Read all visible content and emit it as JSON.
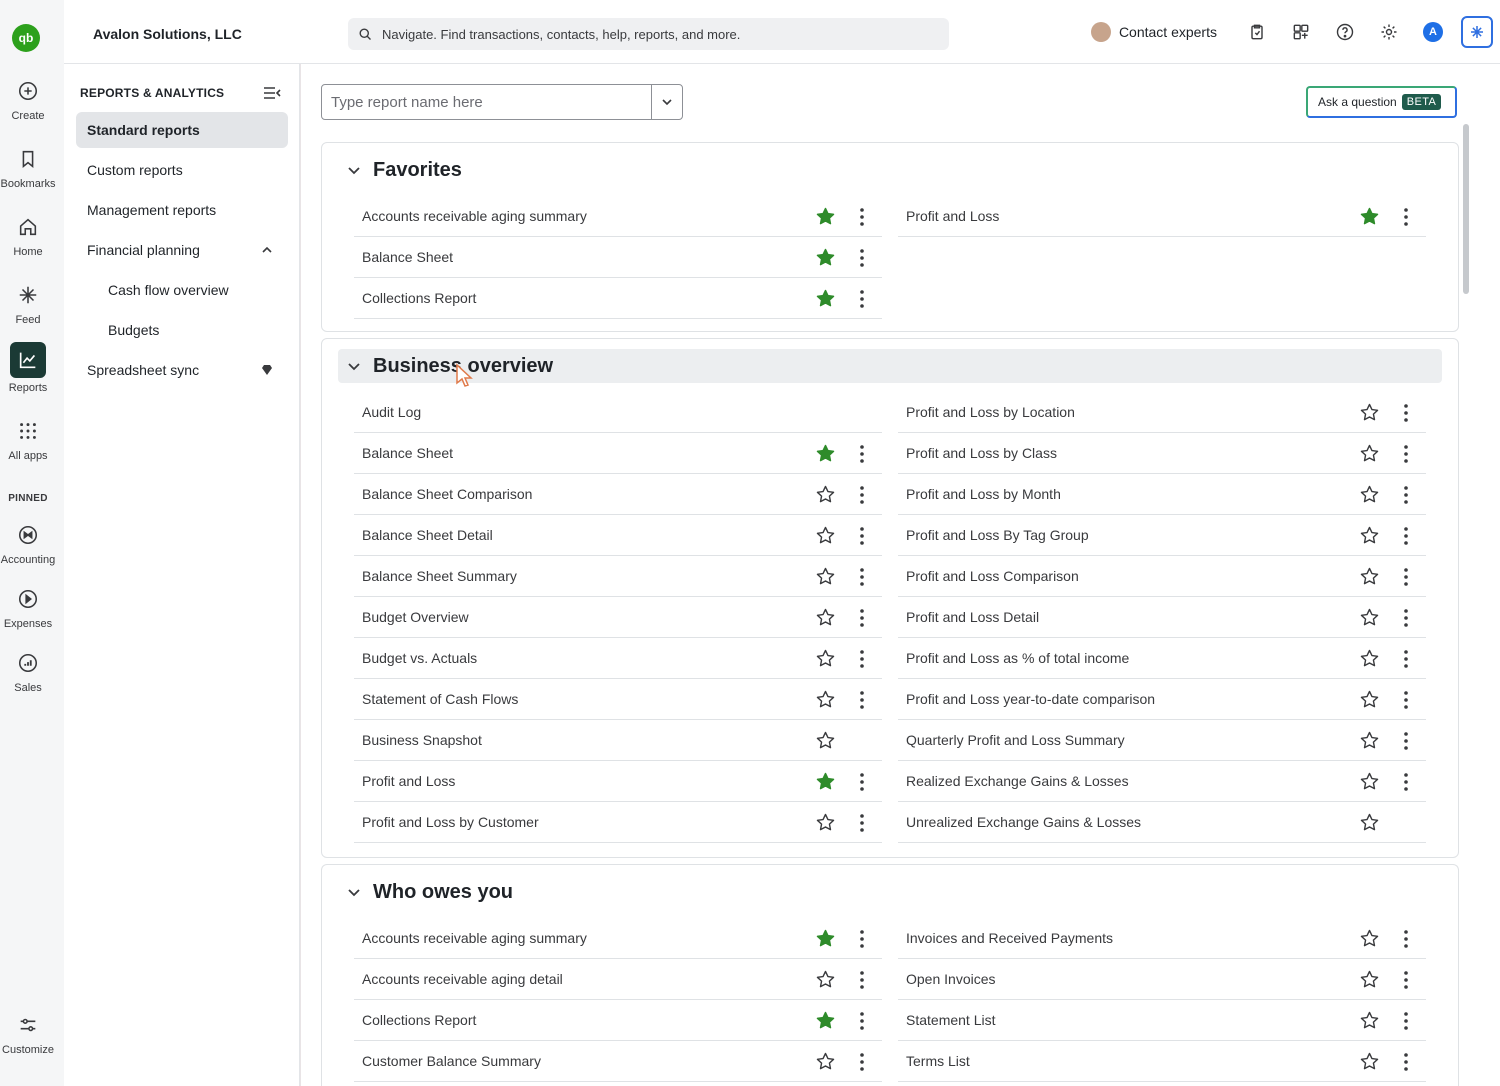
{
  "app": {
    "company": "Avalon Solutions, LLC",
    "search_placeholder": "Navigate. Find transactions, contacts, help, reports, and more.",
    "contact_label": "Contact experts",
    "avatar_initial": "A",
    "logo_text": "qb"
  },
  "rail": {
    "create": "Create",
    "bookmarks": "Bookmarks",
    "home": "Home",
    "feed": "Feed",
    "reports": "Reports",
    "all_apps": "All apps",
    "pinned": "PINNED",
    "accounting": "Accounting",
    "expenses": "Expenses",
    "sales": "Sales",
    "customize": "Customize"
  },
  "sidenav": {
    "title": "REPORTS & ANALYTICS",
    "items": [
      "Standard reports",
      "Custom reports",
      "Management reports",
      "Financial planning",
      "Cash flow overview",
      "Budgets",
      "Spreadsheet sync"
    ]
  },
  "toolbar": {
    "report_placeholder": "Type report name here",
    "ask_label": "Ask a question",
    "beta": "BETA"
  },
  "sections": {
    "favorites": {
      "title": "Favorites",
      "left": [
        {
          "name": "Accounts receivable aging summary",
          "fav": true
        },
        {
          "name": "Balance Sheet",
          "fav": true
        },
        {
          "name": "Collections Report",
          "fav": true
        }
      ],
      "right": [
        {
          "name": "Profit and Loss",
          "fav": true
        }
      ]
    },
    "business": {
      "title": "Business overview",
      "left": [
        {
          "name": "Audit Log"
        },
        {
          "name": "Balance Sheet",
          "fav": true
        },
        {
          "name": "Balance Sheet Comparison"
        },
        {
          "name": "Balance Sheet Detail"
        },
        {
          "name": "Balance Sheet Summary"
        },
        {
          "name": "Budget Overview"
        },
        {
          "name": "Budget vs. Actuals"
        },
        {
          "name": "Statement of Cash Flows"
        },
        {
          "name": "Business Snapshot"
        },
        {
          "name": "Profit and Loss",
          "fav": true
        },
        {
          "name": "Profit and Loss by Customer"
        }
      ],
      "right": [
        {
          "name": "Profit and Loss by Location"
        },
        {
          "name": "Profit and Loss by Class"
        },
        {
          "name": "Profit and Loss by Month"
        },
        {
          "name": "Profit and Loss By Tag Group"
        },
        {
          "name": "Profit and Loss Comparison"
        },
        {
          "name": "Profit and Loss Detail"
        },
        {
          "name": "Profit and Loss as % of total income"
        },
        {
          "name": "Profit and Loss year-to-date comparison"
        },
        {
          "name": "Quarterly Profit and Loss Summary"
        },
        {
          "name": "Realized Exchange Gains & Losses"
        },
        {
          "name": "Unrealized Exchange Gains & Losses"
        }
      ]
    },
    "owes": {
      "title": "Who owes you",
      "left": [
        {
          "name": "Accounts receivable aging summary",
          "fav": true
        },
        {
          "name": "Accounts receivable aging detail"
        },
        {
          "name": "Collections Report",
          "fav": true
        },
        {
          "name": "Customer Balance Summary"
        }
      ],
      "right": [
        {
          "name": "Invoices and Received Payments"
        },
        {
          "name": "Open Invoices"
        },
        {
          "name": "Statement List"
        },
        {
          "name": "Terms List"
        }
      ]
    }
  },
  "colors": {
    "accent_green": "#2ca01c",
    "active_rail": "#1b3a35",
    "star_fill": "#2e8b2a"
  }
}
